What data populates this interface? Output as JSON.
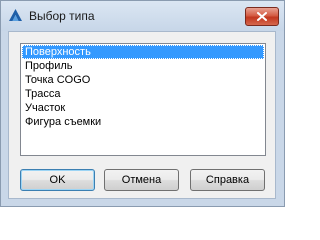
{
  "window": {
    "title": "Выбор типа",
    "icon": "autodesk-civil-a-icon",
    "close_icon": "close-x-icon"
  },
  "listbox": {
    "items": [
      {
        "label": "Поверхность",
        "selected": true
      },
      {
        "label": "Профиль",
        "selected": false
      },
      {
        "label": "Точка COGO",
        "selected": false
      },
      {
        "label": "Трасса",
        "selected": false
      },
      {
        "label": "Участок",
        "selected": false
      },
      {
        "label": "Фигура съемки",
        "selected": false
      }
    ]
  },
  "buttons": {
    "ok_label": "OK",
    "cancel_label": "Отмена",
    "help_label": "Справка"
  },
  "colors": {
    "selection": "#3399ff",
    "title_bar": "#c9d7e8",
    "close_button": "#c84a33"
  }
}
